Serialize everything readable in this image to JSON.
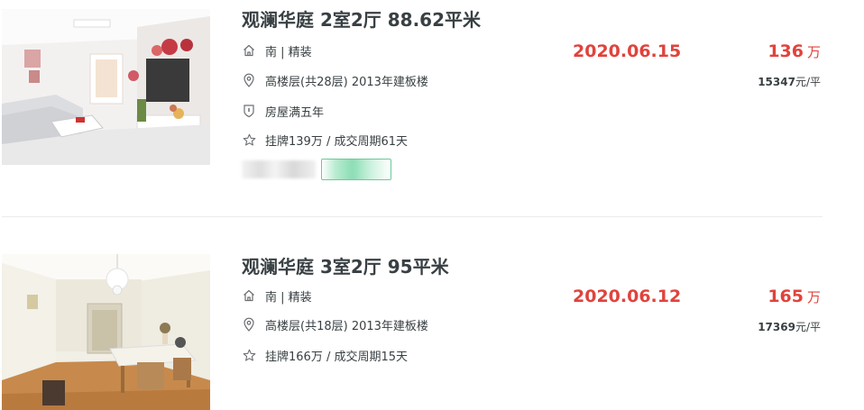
{
  "listings": [
    {
      "title": "观澜华庭 2室2厅 88.62平米",
      "orientation_decor": "南 | 精装",
      "floor_info": "高楼层(共28层) 2013年建板楼",
      "tax_info": "房屋满五年",
      "listing_info": "挂牌139万 / 成交周期61天",
      "deal_date": "2020.06.15",
      "total_price": "136",
      "total_price_unit": "万",
      "unit_price": "15347",
      "unit_price_suffix": "元/平",
      "image": "living-room photo with sofa, TV and bouquet"
    },
    {
      "title": "观澜华庭 3室2厅 95平米",
      "orientation_decor": "南 | 精装",
      "floor_info": "高楼层(共18层) 2013年建板楼",
      "listing_info": "挂牌166万 / 成交周期15天",
      "deal_date": "2020.06.12",
      "total_price": "165",
      "total_price_unit": "万",
      "unit_price": "17369",
      "unit_price_suffix": "元/平",
      "image": "dining room photo with chandelier and wooden floor"
    }
  ],
  "colors": {
    "accent_red": "#e0433c",
    "text": "#394043",
    "divider": "#ececec",
    "tag_green": "#6cc99a"
  },
  "icons": [
    "house-icon",
    "location-pin-icon",
    "shield-icon",
    "star-icon"
  ]
}
